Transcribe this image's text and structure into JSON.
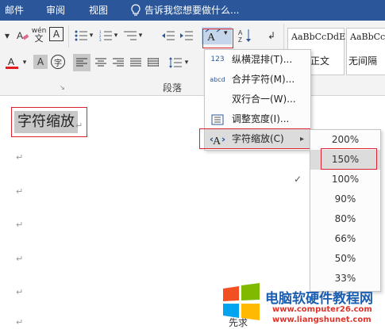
{
  "ribbon_tabs": [
    "邮件",
    "审阅",
    "视图"
  ],
  "tell_me": "告诉我您想要做什么...",
  "toolbar": {
    "phonetic_label": "wén",
    "enclosed_char": "A",
    "circle_char": "字",
    "sort_label": "A Z",
    "paragraph_group": "段落"
  },
  "styles": [
    {
      "sample": "AaBbCcDdE",
      "label": "正文"
    },
    {
      "sample": "AaBbCcDd",
      "label": "无间隔"
    }
  ],
  "document": {
    "selected_text": "字符缩放",
    "para_mark": "↵",
    "bottom_text": "先求"
  },
  "menu": {
    "items": [
      {
        "icon": "123",
        "label": "纵横混排(T)..."
      },
      {
        "icon": "abcd",
        "label": "合并字符(M)..."
      },
      {
        "icon": "",
        "label": "双行合一(W)..."
      },
      {
        "icon": "",
        "label": "调整宽度(I)..."
      },
      {
        "icon": "A",
        "label": "字符缩放(C)",
        "arrow": "▸"
      }
    ]
  },
  "submenu": {
    "items": [
      "200%",
      "150%",
      "100%",
      "90%",
      "80%",
      "66%",
      "50%",
      "33%"
    ],
    "checked": "100%",
    "check_mark": "✓"
  },
  "watermark": {
    "title": "电脑软硬件教程网",
    "url": "www.computer26.com",
    "url2": "www.liangshunet.com"
  },
  "colors": {
    "ribbon_blue": "#2b579a",
    "highlight_red": "#d9232e",
    "selection_gray": "#c8c8c8",
    "hover_gray": "#dcdcdc"
  }
}
